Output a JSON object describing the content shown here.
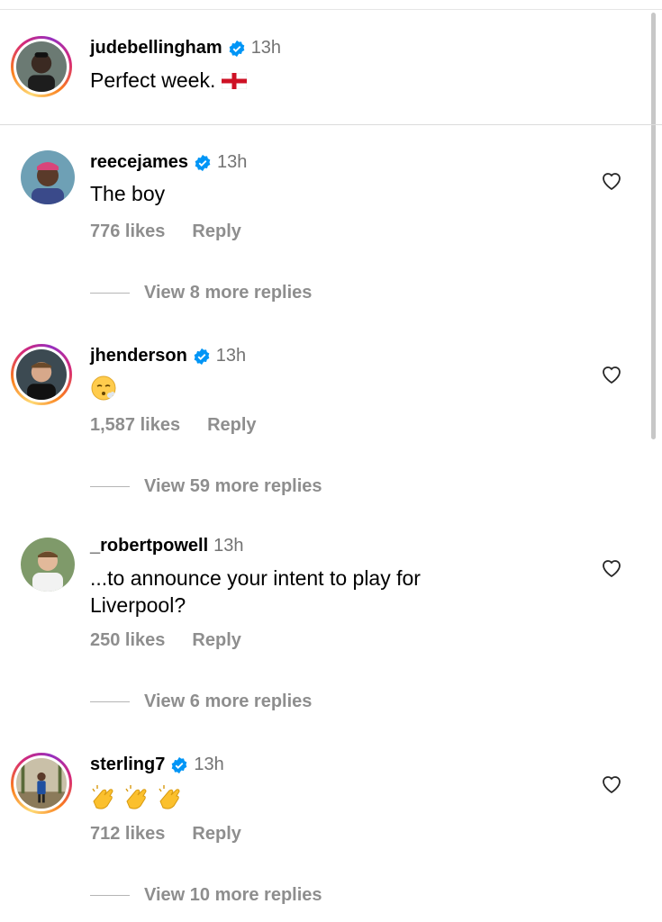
{
  "post": {
    "username": "judebellingham",
    "time": "13h",
    "caption": "Perfect week. ",
    "flag_icon": "england-flag-icon"
  },
  "comments": [
    {
      "username": "reecejames",
      "verified": true,
      "time": "13h",
      "text": "The boy",
      "likes": "776 likes",
      "reply": "Reply",
      "view_replies": "View 8 more replies"
    },
    {
      "username": "jhenderson",
      "verified": true,
      "time": "13h",
      "text": "😮‍💨",
      "likes": "1,587 likes",
      "reply": "Reply",
      "view_replies": "View 59 more replies"
    },
    {
      "username": "_robertpowell",
      "verified": false,
      "time": "13h",
      "text_line1": "...to announce your intent to play for",
      "text_line2": "Liverpool?",
      "likes": "250 likes",
      "reply": "Reply",
      "view_replies": "View 6 more replies"
    },
    {
      "username": "sterling7",
      "verified": true,
      "time": "13h",
      "text": "👏👏👏",
      "likes": "712 likes",
      "reply": "Reply",
      "view_replies": "View 10 more replies"
    }
  ],
  "colors": {
    "verified": "#0095f6",
    "muted": "#8e8e8e",
    "time": "#737373"
  }
}
